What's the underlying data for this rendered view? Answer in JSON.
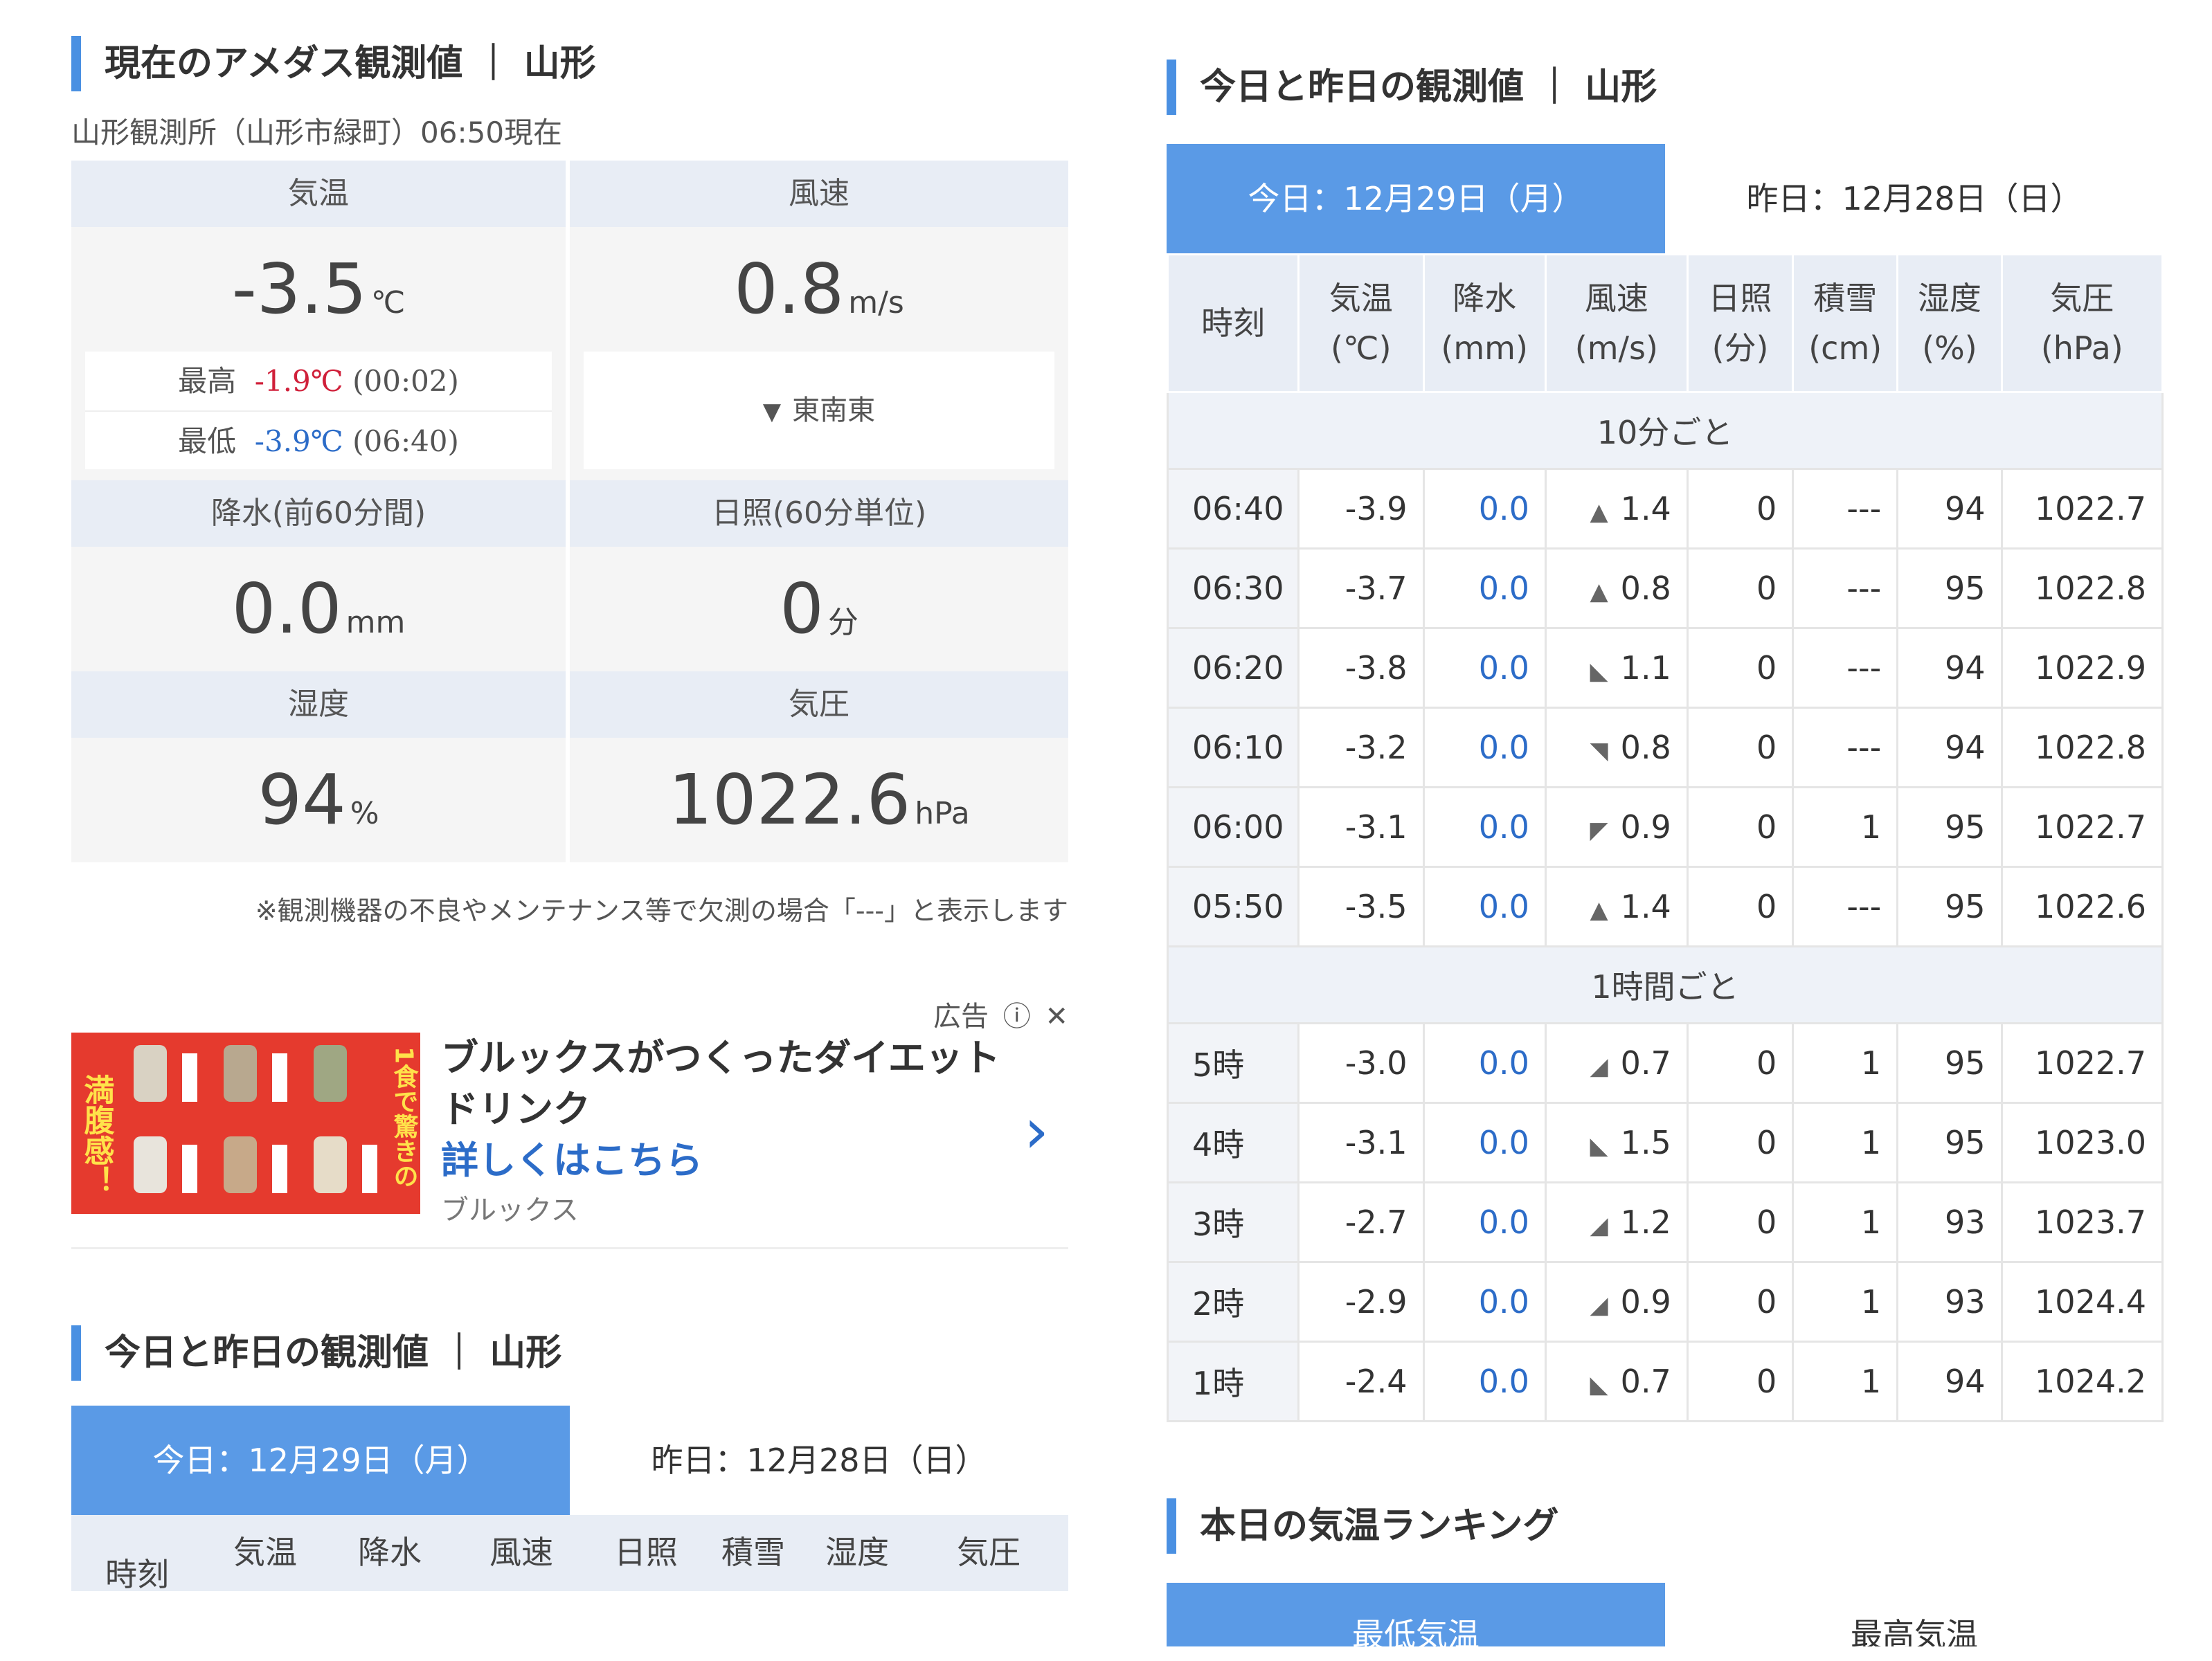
{
  "left": {
    "current": {
      "title": "現在のアメダス観測値 ｜ 山形",
      "subtitle": "山形観測所（山形市緑町）06:50現在",
      "temp": {
        "label": "気温",
        "value": "-3.5",
        "unit": "℃",
        "max_label": "最高",
        "max_value": "-1.9℃",
        "max_time": "(00:02)",
        "min_label": "最低",
        "min_value": "-3.9℃",
        "min_time": "(06:40)"
      },
      "wind": {
        "label": "風速",
        "value": "0.8",
        "unit": "m/s",
        "direction": "東南東",
        "direction_icon": "wind-arrow-icon"
      },
      "precip": {
        "label": "降水(前60分間)",
        "value": "0.0",
        "unit": "mm"
      },
      "sun": {
        "label": "日照(60分単位)",
        "value": "0",
        "unit": "分"
      },
      "humidity": {
        "label": "湿度",
        "value": "94",
        "unit": "%"
      },
      "pressure": {
        "label": "気圧",
        "value": "1022.6",
        "unit": "hPa"
      },
      "note": "※観測機器の不良やメンテナンス等で欠測の場合「---」と表示します"
    },
    "ad": {
      "label": "広告",
      "title": "ブルックスがつくったダイエットドリンク",
      "link": "詳しくはこちら",
      "brand": "ブルックス",
      "image_text_left": "満腹感！",
      "image_text_right": "1食で驚きの"
    },
    "section2": {
      "title": "今日と昨日の観測値 ｜ 山形",
      "tab_today": "今日：12月29日（月）",
      "tab_yesterday": "昨日：12月28日（日）",
      "headers": [
        "時刻",
        "気温",
        "降水",
        "風速",
        "日照",
        "積雪",
        "湿度",
        "気圧"
      ]
    }
  },
  "right": {
    "title": "今日と昨日の観測値 ｜ 山形",
    "tab_today": "今日：12月29日（月）",
    "tab_yesterday": "昨日：12月28日（日）",
    "headers": [
      {
        "name": "時刻",
        "unit": ""
      },
      {
        "name": "気温",
        "unit": "(℃)"
      },
      {
        "name": "降水",
        "unit": "(mm)"
      },
      {
        "name": "風速",
        "unit": "(m/s)"
      },
      {
        "name": "日照",
        "unit": "(分)"
      },
      {
        "name": "積雪",
        "unit": "(cm)"
      },
      {
        "name": "湿度",
        "unit": "(%)"
      },
      {
        "name": "気圧",
        "unit": "(hPa)"
      }
    ],
    "group_10min": "10分ごと",
    "rows_10min": [
      {
        "time": "06:40",
        "temp": "-3.9",
        "precip": "0.0",
        "wind_dir": "▲",
        "wind": "1.4",
        "sun": "0",
        "snow": "---",
        "hum": "94",
        "pres": "1022.7"
      },
      {
        "time": "06:30",
        "temp": "-3.7",
        "precip": "0.0",
        "wind_dir": "▲",
        "wind": "0.8",
        "sun": "0",
        "snow": "---",
        "hum": "95",
        "pres": "1022.8"
      },
      {
        "time": "06:20",
        "temp": "-3.8",
        "precip": "0.0",
        "wind_dir": "◣",
        "wind": "1.1",
        "sun": "0",
        "snow": "---",
        "hum": "94",
        "pres": "1022.9"
      },
      {
        "time": "06:10",
        "temp": "-3.2",
        "precip": "0.0",
        "wind_dir": "◥",
        "wind": "0.8",
        "sun": "0",
        "snow": "---",
        "hum": "94",
        "pres": "1022.8"
      },
      {
        "time": "06:00",
        "temp": "-3.1",
        "precip": "0.0",
        "wind_dir": "◤",
        "wind": "0.9",
        "sun": "0",
        "snow": "1",
        "hum": "95",
        "pres": "1022.7"
      },
      {
        "time": "05:50",
        "temp": "-3.5",
        "precip": "0.0",
        "wind_dir": "▲",
        "wind": "1.4",
        "sun": "0",
        "snow": "---",
        "hum": "95",
        "pres": "1022.6"
      }
    ],
    "group_1h": "1時間ごと",
    "rows_1h": [
      {
        "time": "5時",
        "temp": "-3.0",
        "precip": "0.0",
        "wind_dir": "◢",
        "wind": "0.7",
        "sun": "0",
        "snow": "1",
        "hum": "95",
        "pres": "1022.7"
      },
      {
        "time": "4時",
        "temp": "-3.1",
        "precip": "0.0",
        "wind_dir": "◣",
        "wind": "1.5",
        "sun": "0",
        "snow": "1",
        "hum": "95",
        "pres": "1023.0"
      },
      {
        "time": "3時",
        "temp": "-2.7",
        "precip": "0.0",
        "wind_dir": "◢",
        "wind": "1.2",
        "sun": "0",
        "snow": "1",
        "hum": "93",
        "pres": "1023.7"
      },
      {
        "time": "2時",
        "temp": "-2.9",
        "precip": "0.0",
        "wind_dir": "◢",
        "wind": "0.9",
        "sun": "0",
        "snow": "1",
        "hum": "93",
        "pres": "1024.4"
      },
      {
        "time": "1時",
        "temp": "-2.4",
        "precip": "0.0",
        "wind_dir": "◣",
        "wind": "0.7",
        "sun": "0",
        "snow": "1",
        "hum": "94",
        "pres": "1024.2"
      }
    ],
    "ranking": {
      "title": "本日の気温ランキング",
      "tab_min": "最低気温",
      "tab_max": "最高気温"
    }
  }
}
